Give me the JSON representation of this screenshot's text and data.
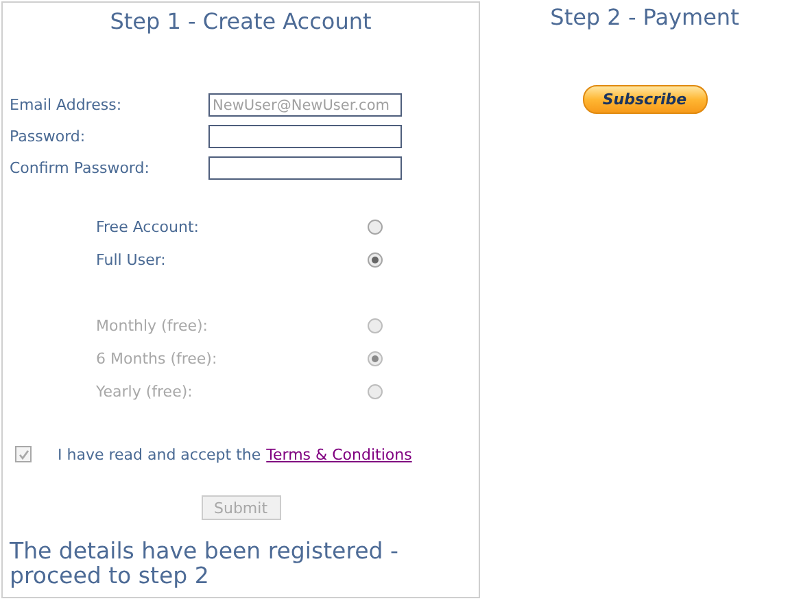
{
  "step1": {
    "title": "Step 1 - Create Account",
    "fields": [
      {
        "label": "Email Address:",
        "placeholder": "NewUser@NewUser.com"
      },
      {
        "label": "Password:"
      },
      {
        "label": "Confirm Password:"
      }
    ],
    "account_types": [
      {
        "label": "Free Account:",
        "selected": false,
        "disabled": false
      },
      {
        "label": "Full User:",
        "selected": true,
        "disabled": false
      }
    ],
    "plans": [
      {
        "label": "Monthly (free):",
        "selected": false,
        "disabled": true
      },
      {
        "label": "6 Months (free):",
        "selected": true,
        "disabled": true
      },
      {
        "label": "Yearly (free):",
        "selected": false,
        "disabled": true
      }
    ],
    "terms": {
      "text": "I have read and accept the",
      "link": "Terms & Conditions",
      "checked": true,
      "disabled": true
    },
    "submit": {
      "label": "Submit",
      "disabled": true
    },
    "message": "The details have been registered - proceed to step 2"
  },
  "step2": {
    "title": "Step 2 - Payment",
    "button": "Subscribe"
  }
}
